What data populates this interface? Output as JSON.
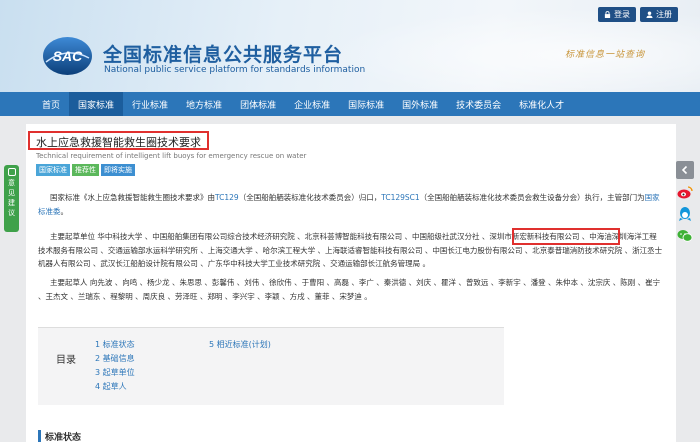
{
  "header": {
    "login_label": "登录",
    "register_label": "注册",
    "logo_text": "SAC",
    "title_cn": "全国标准信息公共服务平台",
    "title_en": "National public service platform  for standards information",
    "slogan": "标准信息一站查询"
  },
  "nav": {
    "items": [
      "首页",
      "国家标准",
      "行业标准",
      "地方标准",
      "团体标准",
      "企业标准",
      "国际标准",
      "国外标准",
      "技术委员会",
      "标准化人才"
    ],
    "active_index": 1
  },
  "doc": {
    "title": "水上应急救援智能救生圈技术要求",
    "subtitle": "Technical requirement of intelligent lift buoys for emergency rescue on water",
    "tags": [
      "国家标准",
      "推荐性",
      "即将实施"
    ]
  },
  "p1": {
    "a": "国家标准《水上应急救援智能救生圈技术要求》由",
    "tc1": "TC129",
    "b": "（全国船舶舾装标准化技术委员会）归口，",
    "tc2": "TC129SC1",
    "c": "（全国船舶舾装标准化技术委员会救生设备分会）执行，主管部门为",
    "dept": "国家标准委",
    "d": "。"
  },
  "p2": {
    "a": "主要起草单位 华中科技大学 、中国船舶集团有限公司综合技术经济研究院 、北京科荟博智能科技有限公司 、中国船级社武汉分社 、",
    "highlight": "深圳市新宏新科技有限公司",
    "b": " 、中海油深圳海洋工程技术服务有限公司 、交通运输部水运科学研究所 、上海交通大学 、哈尔滨工程大学 、上海联适睿智能科技有限公司 、中国长江电力股份有限公司 、北京泰普瑞消防技术研究院 、浙江丞士机器人有限公司 、武汉长江船舶设计院有限公司 、广东华中科技大学工业技术研究院 、交通运输部长江航务管理局 。"
  },
  "p3": {
    "text": "主要起草人 向先波 、向鸣 、杨少龙 、朱思思 、彭馨伟 、刘伟 、徐欣伟 、于曹阳 、高磊 、李广 、秦洪德 、刘庆 、瞿洋 、曾致远 、李新宇 、潘登 、朱仲本 、沈宗庆 、陈刚 、崔宁 、王杰文 、兰瑞东 、程黎明 、周庆良 、劳泽旺 、郑明 、李兴宇 、李颖 、方戌 、董菲 、宋梦迪 。"
  },
  "toc": {
    "label": "目录",
    "items": [
      "1 标准状态",
      "2 基础信息",
      "3 起草单位",
      "4 起草人",
      "5 相近标准(计划)"
    ]
  },
  "section_heading": "标准状态",
  "feedback": {
    "chars": [
      "意",
      "见",
      "建",
      "议"
    ]
  },
  "social": {
    "icons": [
      "back-arrow-icon",
      "weibo-icon",
      "qq-icon",
      "wechat-icon"
    ]
  },
  "colors": {
    "nav_bg": "#2c76b9",
    "nav_active": "#1b5d9c",
    "highlight_border": "#e0302e",
    "feedback_bg": "#3fa14a",
    "link": "#2c76b9"
  }
}
